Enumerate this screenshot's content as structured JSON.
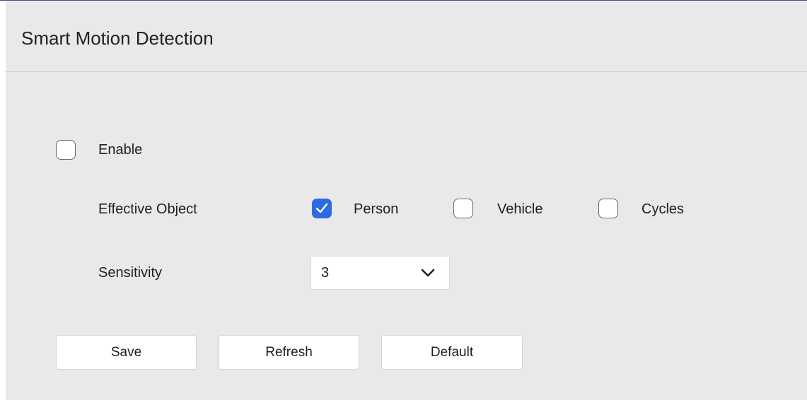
{
  "page": {
    "title": "Smart Motion Detection"
  },
  "enable": {
    "label": "Enable",
    "checked": false
  },
  "effective_object": {
    "label": "Effective Object",
    "options": [
      {
        "label": "Person",
        "checked": true
      },
      {
        "label": "Vehicle",
        "checked": false
      },
      {
        "label": "Cycles",
        "checked": false
      }
    ]
  },
  "sensitivity": {
    "label": "Sensitivity",
    "value": "3"
  },
  "buttons": {
    "save": "Save",
    "refresh": "Refresh",
    "default": "Default"
  },
  "colors": {
    "accent": "#2f6be0",
    "panel_bg": "#e9e9e9",
    "top_line": "#3f4fa8"
  },
  "icons": {
    "check": "check-icon",
    "dropdown": "chevron-down-icon"
  }
}
